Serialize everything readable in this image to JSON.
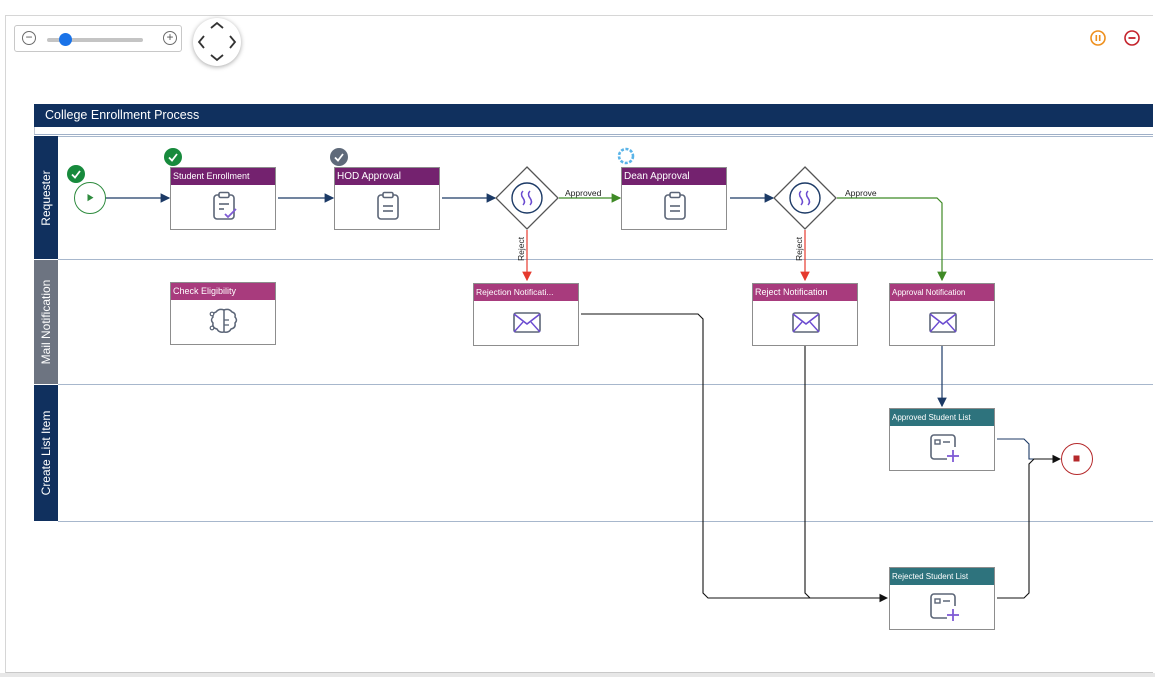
{
  "pool": {
    "title": "College Enrollment Process"
  },
  "lanes": [
    {
      "label": "Requester",
      "color": "#10305e"
    },
    {
      "label": "Mail Notification",
      "color": "#6d7481"
    },
    {
      "label": "Create List Item",
      "color": "#10305e"
    }
  ],
  "tasks": {
    "student_enrollment": {
      "label": "Student Enrollment",
      "color": "#74226f",
      "icon": "clipboard-check-icon",
      "status": "completed"
    },
    "hod_approval": {
      "label": "HOD Approval",
      "color": "#74226f",
      "icon": "clipboard-icon",
      "status": "skipped"
    },
    "dean_approval": {
      "label": "Dean Approval",
      "color": "#74226f",
      "icon": "clipboard-icon",
      "status": "in-progress"
    },
    "check_eligibility": {
      "label": "Check Eligibility",
      "color": "#a83b7d",
      "icon": "brain-circuit-icon"
    },
    "rejection_notification": {
      "label": "Rejection Notificati...",
      "color": "#a83b7d",
      "icon": "mail-icon"
    },
    "reject_notification": {
      "label": "Reject Notification",
      "color": "#a83b7d",
      "icon": "mail-icon"
    },
    "approval_notification": {
      "label": "Approval Notification",
      "color": "#a83b7d",
      "icon": "mail-icon"
    },
    "approved_student_list": {
      "label": "Approved Student List",
      "color": "#2e737d",
      "icon": "list-add-icon"
    },
    "rejected_student_list": {
      "label": "Rejected Student List",
      "color": "#2e737d",
      "icon": "list-add-icon"
    }
  },
  "edges": {
    "approved": "Approved",
    "approve": "Approve",
    "reject_1": "Reject",
    "reject_2": "Reject"
  },
  "colors": {
    "flow_default": "#1c3a66",
    "flow_approve": "#3f8a26",
    "flow_reject": "#e53a2e",
    "flow_black": "#111111",
    "start_event": "#2e8b3e",
    "end_event": "#b5292b",
    "completed_badge": "#178a3c",
    "skipped_badge": "#5f6a7a",
    "in_progress_badge": "#5ab4e8",
    "pause_button": "#ee8f1c",
    "stop_button": "#c4222b"
  },
  "controls": {
    "zoom_in_icon": "plus-circle-icon",
    "zoom_out_icon": "minus-circle-icon",
    "zoom_level": 0.19,
    "pan_icon": "pan-arrows-icon",
    "pause_icon": "pause-circle-icon",
    "stop_icon": "stop-circle-icon"
  }
}
